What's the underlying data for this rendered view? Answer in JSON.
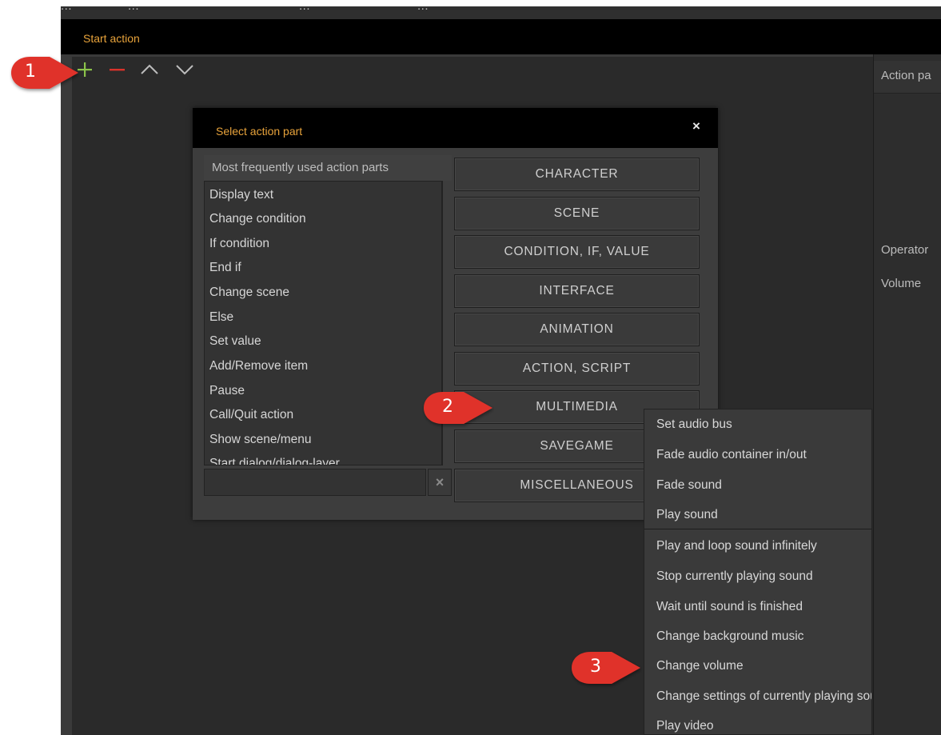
{
  "top_menu": [
    "...",
    "...",
    "...",
    "..."
  ],
  "window": {
    "title": "Start action"
  },
  "toolbar": {
    "add_icon": "plus-icon",
    "remove_icon": "minus-icon",
    "up_icon": "chevron-up-icon",
    "down_icon": "chevron-down-icon"
  },
  "right_panel": {
    "header": "Action pa",
    "operator_label": "Operator",
    "volume_label": "Volume"
  },
  "dialog": {
    "title": "Select action part",
    "close_glyph": "×",
    "frequent_header": "Most frequently used action parts",
    "frequent_items": [
      "Display text",
      "Change condition",
      "If condition",
      "End if",
      "Change scene",
      "Else",
      "Set value",
      "Add/Remove item",
      "Pause",
      "Call/Quit action",
      "Show scene/menu",
      "Start dialog/dialog-layer"
    ],
    "search_value": "",
    "clear_glyph": "×",
    "categories": [
      "CHARACTER",
      "SCENE",
      "CONDITION, IF, VALUE",
      "INTERFACE",
      "ANIMATION",
      "ACTION, SCRIPT",
      "MULTIMEDIA",
      "SAVEGAME",
      "MISCELLANEOUS"
    ]
  },
  "submenu": {
    "items": [
      "Set audio bus",
      "Fade audio container in/out",
      "Fade sound",
      "Play sound",
      "Play and loop sound infinitely",
      "Stop currently playing sound",
      "Wait until sound is finished",
      "Change background music",
      "Change volume",
      "Change settings of currently playing sound",
      "Play video"
    ]
  },
  "callouts": [
    "1",
    "2",
    "3"
  ],
  "colors": {
    "accent_orange": "#e8a33b",
    "add_green": "#8bc34a",
    "remove_red": "#d9322b",
    "callout_red": "#e0312a"
  }
}
